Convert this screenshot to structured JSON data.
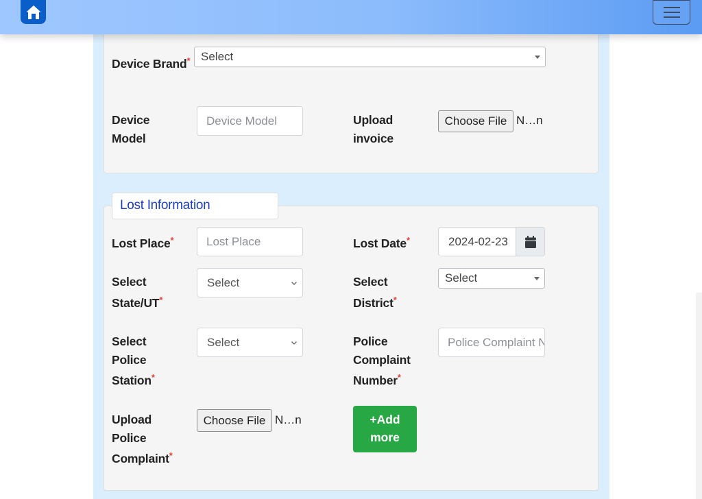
{
  "header": {
    "home_icon": "home-icon",
    "menu_icon": "hamburger-menu-icon"
  },
  "device": {
    "brand_label": "Device Brand",
    "brand_value": "Select",
    "model_label": "Device Model",
    "model_placeholder": "Device Model",
    "invoice_label": "Upload invoice",
    "invoice_button": "Choose File",
    "invoice_file": "N…n"
  },
  "lost": {
    "legend": "Lost Information",
    "place_label": "Lost Place",
    "place_placeholder": "Lost Place",
    "date_label": "Lost Date",
    "date_value": "2024-02-23",
    "state_label_1": "Select",
    "state_label_2": "State/UT",
    "state_value": "Select",
    "district_label_1": "Select",
    "district_label_2": "District",
    "district_value": "Select",
    "station_label_1": "Select",
    "station_label_2": "Police",
    "station_label_3": "Station",
    "station_value": "Select",
    "complaint_label_1": "Police",
    "complaint_label_2": "Complaint",
    "complaint_label_3": "Number",
    "complaint_placeholder": "Police Complaint Number",
    "upload_label_1": "Upload",
    "upload_label_2": "Police",
    "upload_label_3": "Complaint",
    "upload_button": "Choose File",
    "upload_file": "N…n",
    "add_more_1": "+Add",
    "add_more_2": "more"
  },
  "required_mark": "*",
  "colors": {
    "header_start": "#9fc7ff",
    "header_end": "#5b9bf3",
    "home_button": "#0a5ec9",
    "column_bg": "#dbeefd",
    "legend_text": "#1d3fb8",
    "add_button": "#28a745",
    "required": "#e0453a"
  }
}
